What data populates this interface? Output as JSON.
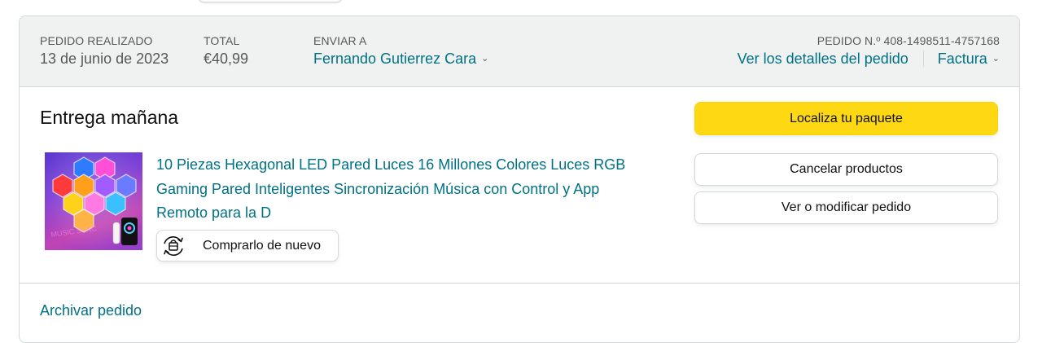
{
  "header": {
    "order_placed_label": "PEDIDO REALIZADO",
    "order_placed_value": "13 de junio de 2023",
    "total_label": "TOTAL",
    "total_value": "€40,99",
    "ship_to_label": "ENVIAR A",
    "ship_to_value": "Fernando Gutierrez Cara",
    "order_number_label": "PEDIDO N.º 408-1498511-4757168",
    "order_details_link": "Ver los detalles del pedido",
    "invoice_link": "Factura"
  },
  "delivery": {
    "status": "Entrega mañana"
  },
  "product": {
    "title": "10 Piezas Hexagonal LED Pared Luces 16 Millones Colores Luces RGB Gaming Pared Inteligentes Sincronización Música con Control y App Remoto para la D",
    "buy_again_label": "Comprarlo de nuevo",
    "image_icon": "hexagon-led-panels-image"
  },
  "actions": {
    "track_package": "Localiza tu paquete",
    "cancel_items": "Cancelar productos",
    "view_modify": "Ver o modificar pedido"
  },
  "footer": {
    "archive_link": "Archivar pedido"
  },
  "colors": {
    "link": "#007185",
    "primary_button": "#FFD814",
    "header_bg": "#F0F2F2",
    "border": "#D5D9D9"
  }
}
